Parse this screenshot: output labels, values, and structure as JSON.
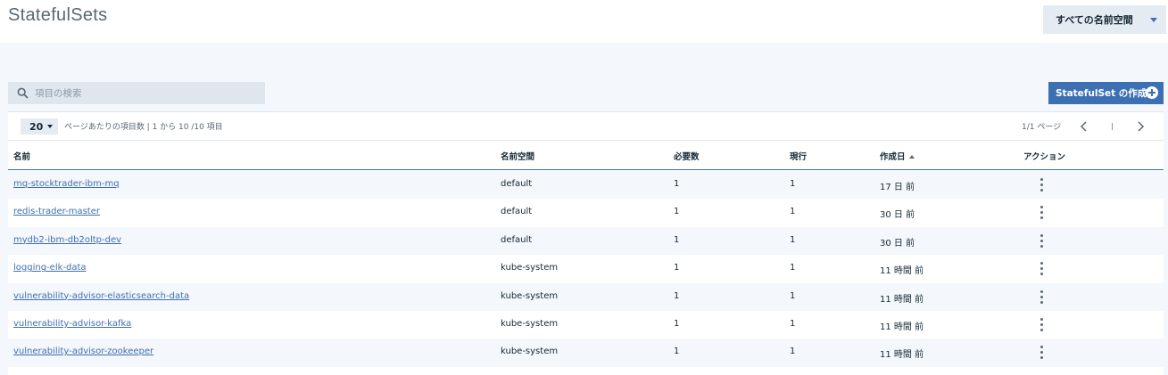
{
  "page": {
    "title": "StatefulSets"
  },
  "namespace_select": {
    "label": "すべての名前空間"
  },
  "search": {
    "placeholder": "項目の検索"
  },
  "create_button": {
    "label": "StatefulSet の作成"
  },
  "pagination": {
    "per_page": "20",
    "per_page_text": "ページあたりの項目数 | 1 から 10 /10 項目",
    "page_info": "1/1 ページ"
  },
  "table": {
    "columns": [
      "名前",
      "名前空間",
      "必要数",
      "現行",
      "作成日",
      "アクション"
    ],
    "sort_column": "作成日",
    "rows": [
      {
        "name": "mq-stocktrader-ibm-mq",
        "namespace": "default",
        "desired": "1",
        "current": "1",
        "created": "17 日 前"
      },
      {
        "name": "redis-trader-master",
        "namespace": "default",
        "desired": "1",
        "current": "1",
        "created": "30 日 前"
      },
      {
        "name": "mydb2-ibm-db2oltp-dev",
        "namespace": "default",
        "desired": "1",
        "current": "1",
        "created": "30 日 前"
      },
      {
        "name": "logging-elk-data",
        "namespace": "kube-system",
        "desired": "1",
        "current": "1",
        "created": "11 時間 前"
      },
      {
        "name": "vulnerability-advisor-elasticsearch-data",
        "namespace": "kube-system",
        "desired": "1",
        "current": "1",
        "created": "11 時間 前"
      },
      {
        "name": "vulnerability-advisor-kafka",
        "namespace": "kube-system",
        "desired": "1",
        "current": "1",
        "created": "11 時間 前"
      },
      {
        "name": "vulnerability-advisor-zookeeper",
        "namespace": "kube-system",
        "desired": "1",
        "current": "1",
        "created": "11 時間 前"
      }
    ]
  },
  "colors": {
    "accent": "#3d70b2",
    "text": "#152935",
    "muted": "#5a6872",
    "row_alt": "#f4f7fb"
  }
}
